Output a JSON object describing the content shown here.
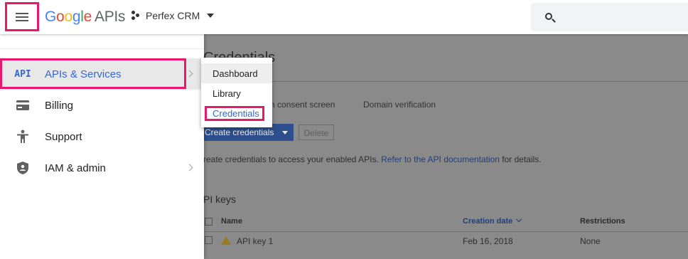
{
  "header": {
    "logo_g": "G",
    "logo_o1": "o",
    "logo_o2": "o",
    "logo_g2": "g",
    "logo_l": "l",
    "logo_e": "e",
    "logo_apis": "APIs",
    "project_name": "Perfex CRM"
  },
  "page": {
    "title": "Credentials",
    "tabs": [
      "uth consent screen",
      "Domain verification"
    ],
    "create_button": "Create credentials",
    "delete_button": "Delete",
    "info_prefix": "reate credentials to access your enabled APIs.",
    "info_link": "Refer to the API documentation",
    "info_suffix": "for details.",
    "section_title": "PI keys",
    "columns": {
      "name": "Name",
      "creation_date": "Creation date",
      "restrictions": "Restrictions"
    },
    "rows": [
      {
        "name": "API key 1",
        "creation_date": "Feb 16, 2018",
        "restrictions": "None"
      }
    ]
  },
  "drawer": {
    "items": [
      {
        "label": "APIs & Services",
        "icon_text": "API"
      },
      {
        "label": "Billing"
      },
      {
        "label": "Support"
      },
      {
        "label": "IAM & admin"
      }
    ]
  },
  "submenu": {
    "items": [
      "Dashboard",
      "Library",
      "Credentials"
    ]
  },
  "colors": {
    "highlight": "#e8196d",
    "accent": "#3367d6"
  }
}
